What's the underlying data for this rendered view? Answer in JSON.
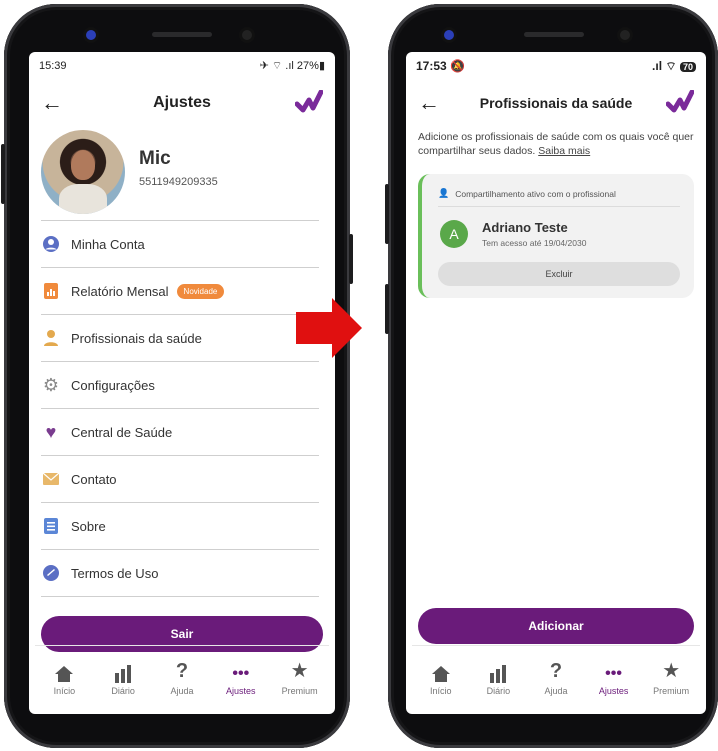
{
  "left_screen": {
    "status": {
      "time": "15:39",
      "right": "27%"
    },
    "header": {
      "title": "Ajustes"
    },
    "profile": {
      "name": "Mic",
      "phone": "5511949209335"
    },
    "menu": [
      {
        "label": "Minha Conta",
        "icon": "user-circle-icon",
        "color": "#5b6fc4"
      },
      {
        "label": "Relatório Mensal",
        "icon": "report-icon",
        "color": "#f08a3c",
        "badge": "Novidade"
      },
      {
        "label": "Profissionais da saúde",
        "icon": "doctor-icon",
        "color": "#e3a94e"
      },
      {
        "label": "Configurações",
        "icon": "gear-icon",
        "color": "#8a8a8a"
      },
      {
        "label": "Central de Saúde",
        "icon": "health-heart-icon",
        "color": "#7a3c8f"
      },
      {
        "label": "Contato",
        "icon": "envelope-icon",
        "color": "#e8b86a"
      },
      {
        "label": "Sobre",
        "icon": "document-icon",
        "color": "#5b86d6"
      },
      {
        "label": "Termos de Uso",
        "icon": "terms-icon",
        "color": "#5b6fc4"
      }
    ],
    "logout_label": "Sair",
    "tabs": [
      {
        "label": "Início",
        "icon": "home-icon"
      },
      {
        "label": "Diário",
        "icon": "bar-chart-icon"
      },
      {
        "label": "Ajuda",
        "icon": "question-icon"
      },
      {
        "label": "Ajustes",
        "icon": "more-dots-icon",
        "active": true
      },
      {
        "label": "Premium",
        "icon": "star-icon"
      }
    ]
  },
  "right_screen": {
    "status": {
      "time": "17:53",
      "battery": "70"
    },
    "header": {
      "title": "Profissionais da saúde"
    },
    "description": "Adicione os profissionais de saúde com os quais você quer compartilhar seus dados.",
    "learn_more": "Saiba mais",
    "card": {
      "heading": "Compartilhamento ativo com o profissional",
      "initial": "A",
      "name": "Adriano Teste",
      "access": "Tem acesso até 19/04/2030",
      "delete_label": "Excluir"
    },
    "add_label": "Adicionar",
    "tabs": [
      {
        "label": "Início",
        "icon": "home-icon"
      },
      {
        "label": "Diário",
        "icon": "bar-chart-icon"
      },
      {
        "label": "Ajuda",
        "icon": "question-icon"
      },
      {
        "label": "Ajustes",
        "icon": "more-dots-icon",
        "active": true
      },
      {
        "label": "Premium",
        "icon": "star-icon"
      }
    ]
  },
  "colors": {
    "accent": "#6a1b7a",
    "arrow": "#e01010",
    "active_border": "#6abf5a"
  }
}
